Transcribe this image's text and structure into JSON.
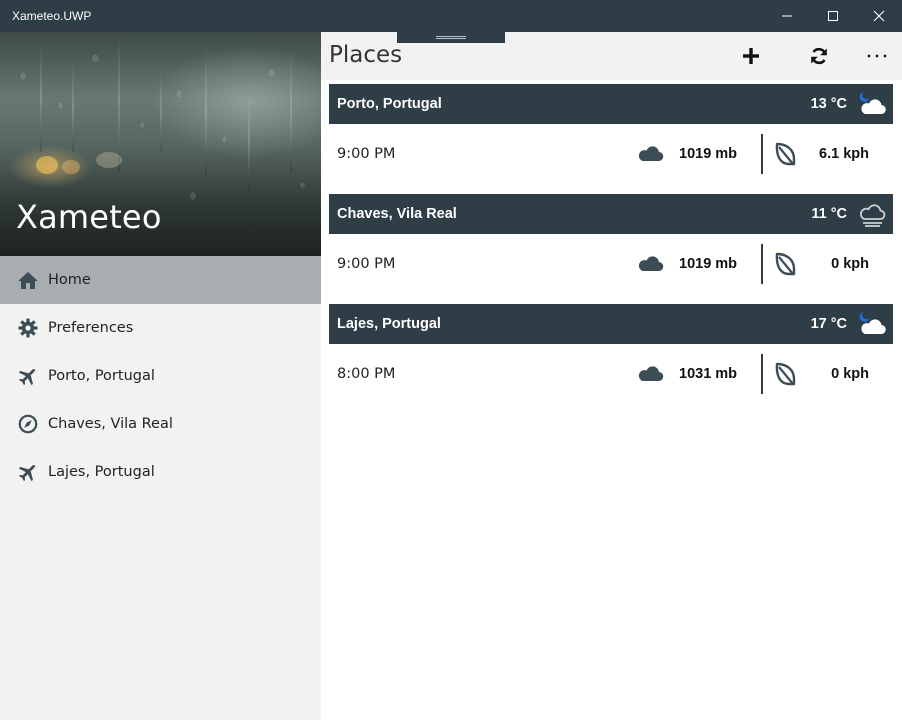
{
  "window": {
    "title": "Xameteo.UWP",
    "controls": {
      "minimize": "minimize-icon",
      "maximize": "maximize-icon",
      "close": "close-icon"
    }
  },
  "sidebar": {
    "hero_title": "Xameteo",
    "items": [
      {
        "label": "Home",
        "icon": "home-icon",
        "active": true
      },
      {
        "label": "Preferences",
        "icon": "gear-icon",
        "active": false
      },
      {
        "label": "Porto, Portugal",
        "icon": "airplane-icon",
        "active": false
      },
      {
        "label": "Chaves, Vila Real",
        "icon": "compass-icon",
        "active": false
      },
      {
        "label": "Lajes, Portugal",
        "icon": "airplane-icon",
        "active": false
      }
    ]
  },
  "main": {
    "title": "Places",
    "commands": {
      "add": "plus-icon",
      "refresh": "refresh-icon",
      "more": "more-icon"
    },
    "places": [
      {
        "name": "Porto, Portugal",
        "temperature": "13 °C",
        "condition_icon": "night-cloudy-icon",
        "time": "9:00 PM",
        "pressure": "1019 mb",
        "wind": "6.1 kph"
      },
      {
        "name": "Chaves, Vila Real",
        "temperature": "11 °C",
        "condition_icon": "fog-cloud-icon",
        "time": "9:00 PM",
        "pressure": "1019 mb",
        "wind": "0 kph"
      },
      {
        "name": "Lajes, Portugal",
        "temperature": "17 °C",
        "condition_icon": "night-cloudy-icon",
        "time": "8:00 PM",
        "pressure": "1031 mb",
        "wind": "0 kph"
      }
    ]
  },
  "colors": {
    "accent": "#2f3e46",
    "sidebar_bg": "#f2f2f2",
    "active_item_bg": "#a8aeb0",
    "icon_color": "#3d4d55",
    "moon": "#1e6fd9"
  }
}
